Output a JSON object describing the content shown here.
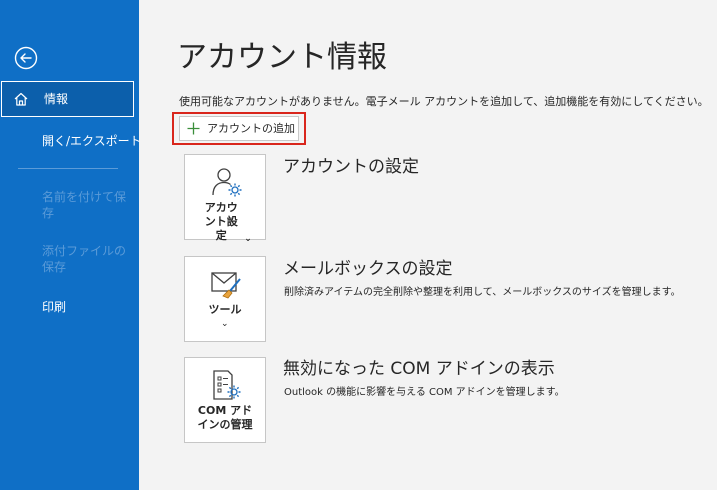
{
  "nav": {
    "active_label": "情報",
    "items": [
      {
        "label": "開く/エクスポート",
        "disabled": false
      },
      {
        "label": "名前を付けて保存",
        "disabled": true
      },
      {
        "label": "添付ファイルの保存",
        "disabled": true
      },
      {
        "label": "印刷",
        "disabled": false
      }
    ]
  },
  "page": {
    "title": "アカウント情報",
    "notice": "使用可能なアカウントがありません。電子メール アカウントを追加して、追加機能を有効にしてください。",
    "add_account_label": "アカウントの追加"
  },
  "sections": [
    {
      "tile_label": "アカウント設定",
      "title": "アカウントの設定",
      "description": ""
    },
    {
      "tile_label": "ツール",
      "title": "メールボックスの設定",
      "description": "削除済みアイテムの完全削除や整理を利用して、メールボックスのサイズを管理します。"
    },
    {
      "tile_label": "COM アドインの管理",
      "title": "無効になった COM アドインの表示",
      "description": "Outlook の機能に影響を与える COM アドインを管理します。"
    }
  ],
  "colors": {
    "sidebar": "#0f6fc6",
    "highlight": "#d9261c",
    "accent_green": "#3a8e3a",
    "accent_blue": "#1e6fbf"
  }
}
